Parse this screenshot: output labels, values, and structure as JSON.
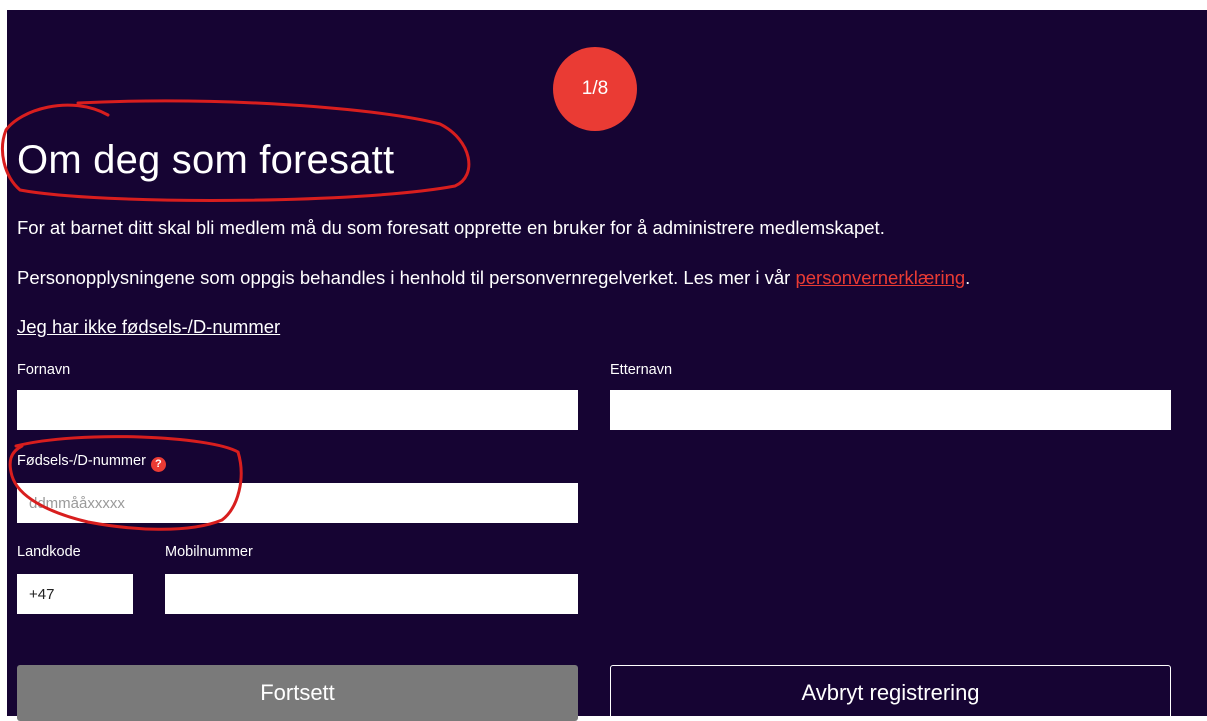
{
  "step": {
    "indicator": "1/8"
  },
  "page": {
    "title": "Om deg som foresatt",
    "intro_1": "For at barnet ditt skal bli medlem må du som foresatt opprette en bruker for å administrere medlemskapet.",
    "intro_2_prefix": "Personopplysningene som oppgis behandles i henhold til personvernregelverket. Les mer i vår ",
    "privacy_link": "personvernerklæring",
    "intro_2_suffix": ".",
    "no_id_link": "Jeg har ikke fødsels-/D-nummer"
  },
  "form": {
    "first_name": {
      "label": "Fornavn",
      "value": ""
    },
    "last_name": {
      "label": "Etternavn",
      "value": ""
    },
    "national_id": {
      "label": "Fødsels-/D-nummer",
      "placeholder": "ddmmååxxxxx",
      "help_icon": "?"
    },
    "country_code": {
      "label": "Landkode",
      "value": "+47"
    },
    "mobile": {
      "label": "Mobilnummer",
      "value": ""
    }
  },
  "buttons": {
    "continue": "Fortsett",
    "cancel": "Avbryt registrering"
  },
  "colors": {
    "background": "#160433",
    "accent": "#ea3b34",
    "disabled_button": "#7a7a7a",
    "annotation": "#d81e1e"
  }
}
